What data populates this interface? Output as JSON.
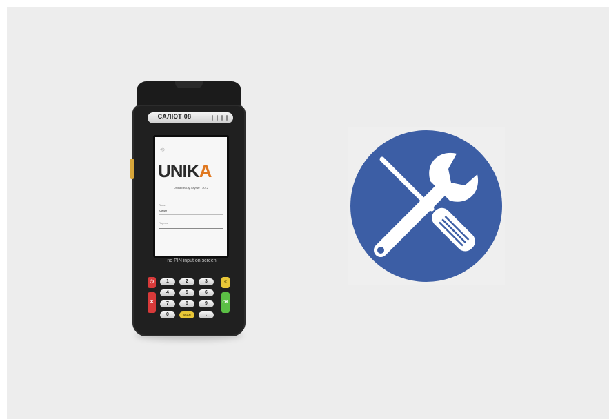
{
  "device": {
    "brand": "САЛЮТ 08",
    "screen": {
      "back_symbol": "⟲",
      "logo_main": "UNIK",
      "logo_accent": "A",
      "subtitle": "Unika Beauty Лаунит / 2012",
      "field_label": "Логин",
      "field_value": "Админ",
      "input_placeholder": "Пароль"
    },
    "caption": "no PIN input on screen",
    "keys": {
      "power": "⏻",
      "cancel": "✕",
      "clear": "<",
      "ok": "OK",
      "digits": [
        "1",
        "2",
        "3",
        "4",
        "5",
        "6",
        "7",
        "8",
        "9",
        "0",
        "SCAN",
        "."
      ]
    },
    "colors": {
      "body": "#202020",
      "side_key": "#d7a63a",
      "logo_accent": "#e07820"
    }
  },
  "tools_icon": {
    "name": "tools-icon",
    "circle_color": "#3c5ea5",
    "glyph_color": "#ffffff"
  }
}
